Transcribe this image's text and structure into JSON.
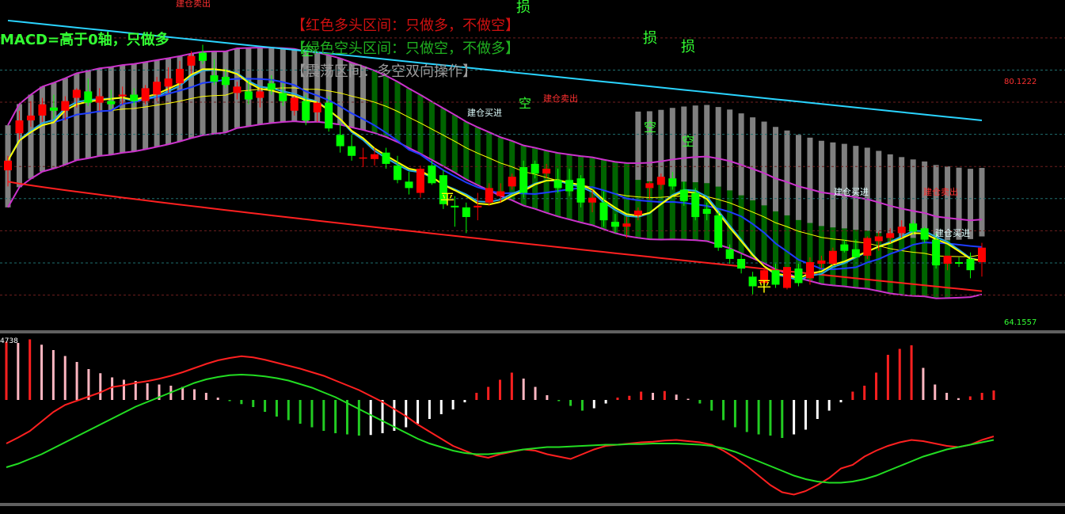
{
  "header": {
    "macd_text": "MACD=高于0轴，只做多",
    "red_zone_text": "【红色多头区间：只做多，不做空】",
    "green_zone_text": "【绿色空头区间：只做空，不做多】",
    "gray_zone_text": "【震荡区间：多空双向操作】"
  },
  "colors": {
    "background": "#000000",
    "candle_up": "#ff0000",
    "candle_down": "#00ff00",
    "band_edge": "#cc33cc",
    "band_gray": "#808080",
    "band_green": "#006400",
    "ma_yellow": "#ffff00",
    "ma_blue": "#1e3cff",
    "ma_cyan": "#29a8e0",
    "top_cyan": "#2ad4ff",
    "support_red": "#ff2020",
    "hist_red": "#ff2020",
    "hist_pink": "#ffb6c1",
    "hist_green": "#22cc22",
    "hist_white": "#ffffff",
    "dif_line": "#ff2020",
    "dea_line": "#22dd22"
  },
  "chart_data": [
    {
      "type": "candlestick",
      "panel": "price",
      "ylim": [
        64.1557,
        80.1222
      ],
      "price_labels": {
        "top": "80.1222",
        "bottom": "64.1557"
      },
      "annotations": [
        {
          "text": "建仓卖出",
          "kind": "sell"
        },
        {
          "text": "损",
          "kind": "stop"
        },
        {
          "text": "损",
          "kind": "stop"
        },
        {
          "text": "损",
          "kind": "stop"
        },
        {
          "text": "空",
          "kind": "short"
        },
        {
          "text": "空",
          "kind": "short"
        },
        {
          "text": "空",
          "kind": "short"
        },
        {
          "text": "空",
          "kind": "short"
        },
        {
          "text": "建仓买进",
          "kind": "buy"
        },
        {
          "text": "建仓卖出",
          "kind": "sell"
        },
        {
          "text": "平",
          "kind": "close"
        },
        {
          "text": "平",
          "kind": "close"
        },
        {
          "text": "建仓买进",
          "kind": "buy"
        },
        {
          "text": "建仓卖出",
          "kind": "sell"
        },
        {
          "text": "建仓买进",
          "kind": "buy"
        }
      ],
      "candles": [
        [
          71.9,
          72.8,
          70.9,
          72.5
        ],
        [
          74.2,
          75.6,
          73.8,
          75.0
        ],
        [
          75.0,
          76.2,
          74.6,
          75.3
        ],
        [
          75.3,
          76.4,
          74.9,
          76.0
        ],
        [
          75.8,
          76.6,
          75.1,
          75.6
        ],
        [
          75.6,
          76.5,
          75.0,
          76.2
        ],
        [
          76.4,
          77.0,
          75.8,
          76.9
        ],
        [
          76.8,
          77.6,
          75.9,
          76.1
        ],
        [
          76.1,
          77.0,
          75.6,
          76.5
        ],
        [
          76.2,
          76.9,
          75.7,
          76.0
        ],
        [
          76.5,
          77.1,
          76.0,
          76.6
        ],
        [
          76.6,
          77.0,
          75.9,
          76.2
        ],
        [
          76.2,
          77.2,
          76.0,
          77.0
        ],
        [
          76.6,
          77.7,
          76.2,
          77.4
        ],
        [
          77.1,
          78.3,
          76.7,
          77.6
        ],
        [
          77.3,
          78.7,
          77.0,
          78.2
        ],
        [
          78.4,
          79.3,
          77.9,
          79.0
        ],
        [
          79.2,
          79.7,
          78.5,
          78.7
        ],
        [
          77.8,
          78.8,
          77.2,
          77.4
        ],
        [
          77.7,
          78.2,
          77.0,
          77.2
        ],
        [
          76.7,
          77.4,
          76.3,
          77.1
        ],
        [
          76.8,
          77.5,
          76.0,
          76.3
        ],
        [
          76.4,
          77.0,
          75.8,
          76.8
        ],
        [
          77.3,
          77.8,
          76.6,
          76.9
        ],
        [
          76.7,
          77.3,
          75.9,
          76.2
        ],
        [
          75.6,
          76.5,
          75.3,
          76.4
        ],
        [
          76.2,
          76.6,
          74.7,
          75.0
        ],
        [
          75.5,
          76.2,
          74.9,
          76.1
        ],
        [
          76.1,
          76.5,
          74.3,
          74.5
        ],
        [
          74.1,
          74.8,
          73.0,
          73.4
        ],
        [
          73.4,
          74.1,
          72.5,
          72.8
        ],
        [
          72.7,
          73.3,
          72.1,
          72.7
        ],
        [
          72.6,
          73.3,
          72.2,
          72.9
        ],
        [
          73.0,
          73.3,
          72.0,
          72.3
        ],
        [
          72.2,
          72.8,
          71.1,
          71.3
        ],
        [
          71.2,
          71.8,
          70.4,
          70.8
        ],
        [
          70.5,
          72.2,
          70.2,
          72.0
        ],
        [
          72.2,
          72.5,
          71.0,
          71.1
        ],
        [
          71.6,
          71.9,
          69.5,
          69.8
        ],
        [
          69.7,
          70.3,
          68.4,
          69.6
        ],
        [
          69.6,
          69.9,
          68.0,
          69.0
        ],
        [
          69.6,
          70.5,
          68.8,
          69.7
        ],
        [
          69.9,
          71.1,
          69.7,
          70.8
        ],
        [
          70.3,
          71.1,
          69.9,
          70.6
        ],
        [
          70.9,
          71.7,
          70.7,
          71.5
        ],
        [
          72.1,
          72.5,
          70.2,
          70.5
        ],
        [
          72.3,
          72.5,
          71.4,
          71.7
        ],
        [
          71.7,
          72.3,
          71.4,
          72.0
        ],
        [
          71.3,
          72.0,
          70.5,
          70.8
        ],
        [
          71.3,
          72.0,
          70.3,
          70.6
        ],
        [
          71.4,
          71.6,
          69.6,
          69.9
        ],
        [
          69.9,
          70.7,
          69.3,
          70.2
        ],
        [
          69.9,
          70.6,
          68.4,
          68.8
        ],
        [
          68.7,
          69.2,
          68.0,
          68.4
        ],
        [
          68.4,
          69.0,
          67.7,
          68.6
        ],
        [
          69.1,
          69.6,
          68.8,
          69.4
        ],
        [
          70.8,
          71.2,
          70.1,
          71.1
        ],
        [
          71.0,
          71.7,
          70.7,
          71.5
        ],
        [
          71.4,
          71.8,
          70.7,
          70.9
        ],
        [
          70.7,
          71.2,
          69.7,
          70.0
        ],
        [
          70.5,
          70.8,
          68.8,
          69.0
        ],
        [
          69.5,
          69.9,
          68.8,
          69.2
        ],
        [
          69.1,
          69.3,
          66.9,
          67.1
        ],
        [
          67.0,
          67.3,
          66.1,
          66.4
        ],
        [
          66.4,
          66.7,
          65.5,
          65.8
        ],
        [
          65.3,
          65.6,
          64.2,
          64.7
        ],
        [
          64.9,
          65.8,
          64.3,
          65.7
        ],
        [
          65.7,
          66.1,
          64.6,
          64.8
        ],
        [
          64.6,
          65.6,
          64.5,
          65.9
        ],
        [
          65.8,
          66.1,
          64.7,
          64.9
        ],
        [
          65.2,
          66.5,
          64.8,
          66.2
        ],
        [
          66.1,
          66.6,
          65.8,
          66.3
        ],
        [
          66.1,
          67.1,
          66.0,
          66.9
        ],
        [
          67.3,
          67.6,
          66.8,
          66.9
        ],
        [
          67.0,
          67.6,
          66.5,
          66.5
        ],
        [
          66.6,
          67.8,
          66.4,
          67.7
        ],
        [
          67.5,
          68.1,
          66.9,
          67.8
        ],
        [
          67.7,
          68.3,
          67.4,
          68.0
        ],
        [
          68.0,
          68.8,
          67.7,
          68.4
        ],
        [
          68.6,
          68.8,
          67.9,
          68.1
        ],
        [
          68.3,
          68.4,
          67.4,
          67.6
        ],
        [
          67.6,
          68.0,
          65.8,
          66.0
        ],
        [
          66.1,
          66.6,
          65.7,
          66.6
        ],
        [
          66.2,
          66.5,
          65.9,
          66.1
        ],
        [
          66.4,
          66.8,
          65.2,
          65.7
        ],
        [
          66.2,
          67.4,
          65.3,
          67.1
        ]
      ],
      "bands": [
        {
          "zone": "gray",
          "from": 0,
          "to": 31
        },
        {
          "zone": "green",
          "from": 32,
          "to": 82
        },
        {
          "zone": "gray",
          "from": 55,
          "to": 85
        }
      ]
    },
    {
      "type": "bar_line",
      "panel": "macd",
      "axis_label": "4738",
      "histogram": [
        0.98,
        0.96,
        1.02,
        0.93,
        0.84,
        0.74,
        0.64,
        0.52,
        0.45,
        0.38,
        0.34,
        0.32,
        0.28,
        0.26,
        0.24,
        0.22,
        0.18,
        0.12,
        0.04,
        -0.02,
        -0.07,
        -0.12,
        -0.2,
        -0.28,
        -0.34,
        -0.4,
        -0.46,
        -0.52,
        -0.56,
        -0.58,
        -0.6,
        -0.59,
        -0.56,
        -0.52,
        -0.46,
        -0.4,
        -0.32,
        -0.24,
        -0.16,
        -0.04,
        0.12,
        0.22,
        0.34,
        0.46,
        0.36,
        0.22,
        0.08,
        -0.02,
        -0.1,
        -0.18,
        -0.14,
        -0.06,
        0.04,
        0.07,
        0.14,
        0.12,
        0.15,
        0.09,
        0.02,
        -0.06,
        -0.18,
        -0.34,
        -0.46,
        -0.54,
        -0.58,
        -0.6,
        -0.64,
        -0.58,
        -0.5,
        -0.32,
        -0.18,
        -0.04,
        0.14,
        0.24,
        0.46,
        0.76,
        0.86,
        0.92,
        0.54,
        0.26,
        0.12,
        0.03,
        0.06,
        0.12,
        0.16
      ],
      "dif": [
        0.0,
        0.1,
        0.21,
        0.37,
        0.53,
        0.65,
        0.72,
        0.79,
        0.86,
        0.95,
        0.98,
        1.02,
        1.05,
        1.09,
        1.14,
        1.2,
        1.27,
        1.34,
        1.4,
        1.44,
        1.47,
        1.45,
        1.41,
        1.36,
        1.31,
        1.26,
        1.2,
        1.14,
        1.06,
        0.98,
        0.9,
        0.8,
        0.7,
        0.58,
        0.46,
        0.32,
        0.2,
        0.08,
        -0.04,
        -0.12,
        -0.2,
        -0.24,
        -0.18,
        -0.14,
        -0.1,
        -0.12,
        -0.18,
        -0.22,
        -0.26,
        -0.18,
        -0.1,
        -0.04,
        -0.02,
        0.0,
        0.02,
        0.03,
        0.05,
        0.06,
        0.04,
        0.02,
        -0.02,
        -0.12,
        -0.24,
        -0.38,
        -0.54,
        -0.7,
        -0.82,
        -0.86,
        -0.8,
        -0.7,
        -0.58,
        -0.42,
        -0.36,
        -0.22,
        -0.12,
        -0.04,
        0.02,
        0.06,
        0.04,
        0.0,
        -0.04,
        -0.06,
        -0.02,
        0.06,
        0.12
      ],
      "dea": [
        -0.4,
        -0.34,
        -0.26,
        -0.18,
        -0.08,
        0.02,
        0.12,
        0.22,
        0.32,
        0.42,
        0.52,
        0.62,
        0.7,
        0.78,
        0.86,
        0.94,
        1.02,
        1.08,
        1.12,
        1.15,
        1.16,
        1.15,
        1.13,
        1.1,
        1.06,
        1.0,
        0.94,
        0.86,
        0.78,
        0.68,
        0.58,
        0.48,
        0.38,
        0.28,
        0.18,
        0.08,
        0.0,
        -0.06,
        -0.12,
        -0.16,
        -0.18,
        -0.18,
        -0.16,
        -0.13,
        -0.1,
        -0.08,
        -0.06,
        -0.06,
        -0.05,
        -0.04,
        -0.03,
        -0.02,
        -0.02,
        -0.01,
        -0.01,
        0.0,
        0.0,
        0.0,
        -0.01,
        -0.02,
        -0.04,
        -0.08,
        -0.14,
        -0.22,
        -0.3,
        -0.38,
        -0.46,
        -0.54,
        -0.6,
        -0.64,
        -0.66,
        -0.66,
        -0.64,
        -0.6,
        -0.54,
        -0.46,
        -0.38,
        -0.3,
        -0.22,
        -0.16,
        -0.1,
        -0.06,
        -0.02,
        0.02,
        0.06
      ]
    }
  ]
}
